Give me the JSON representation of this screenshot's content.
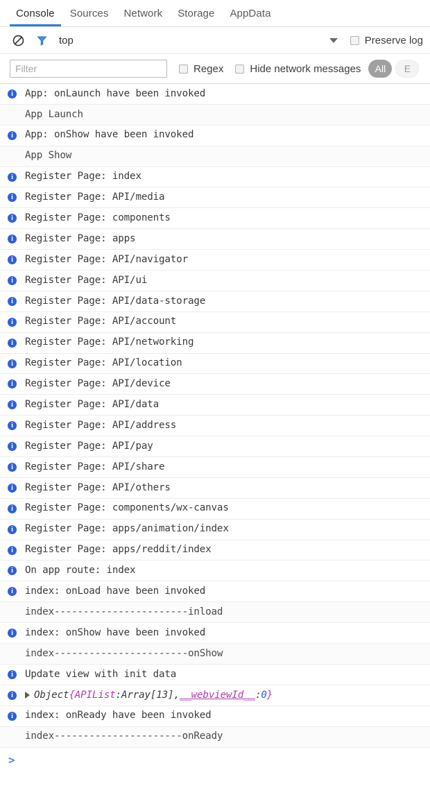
{
  "tabs": [
    {
      "label": "Console",
      "active": true
    },
    {
      "label": "Sources",
      "active": false
    },
    {
      "label": "Network",
      "active": false
    },
    {
      "label": "Storage",
      "active": false
    },
    {
      "label": "AppData",
      "active": false
    }
  ],
  "toolbar": {
    "clear_icon": "clear-console-icon",
    "filter_icon": "filter-funnel-icon",
    "context_label": "top",
    "dropdown_icon": "chevron-down-icon",
    "preserve_log_label": "Preserve log",
    "preserve_log_checked": false
  },
  "filterbar": {
    "filter_placeholder": "Filter",
    "filter_value": "",
    "regex_label": "Regex",
    "regex_checked": false,
    "hide_network_label": "Hide network messages",
    "hide_network_checked": false,
    "level_pill": "All",
    "level_pill_ghost": "E"
  },
  "console": {
    "prompt_symbol": ">",
    "entries": [
      {
        "icon": "info-icon",
        "text": "App: onLaunch have been invoked"
      },
      {
        "icon": null,
        "text": "App Launch"
      },
      {
        "icon": "info-icon",
        "text": "App: onShow have been invoked"
      },
      {
        "icon": null,
        "text": "App Show"
      },
      {
        "icon": "info-icon",
        "text": "Register Page: index"
      },
      {
        "icon": "info-icon",
        "text": "Register Page: API/media"
      },
      {
        "icon": "info-icon",
        "text": "Register Page: components"
      },
      {
        "icon": "info-icon",
        "text": "Register Page: apps"
      },
      {
        "icon": "info-icon",
        "text": "Register Page: API/navigator"
      },
      {
        "icon": "info-icon",
        "text": "Register Page: API/ui"
      },
      {
        "icon": "info-icon",
        "text": "Register Page: API/data-storage"
      },
      {
        "icon": "info-icon",
        "text": "Register Page: API/account"
      },
      {
        "icon": "info-icon",
        "text": "Register Page: API/networking"
      },
      {
        "icon": "info-icon",
        "text": "Register Page: API/location"
      },
      {
        "icon": "info-icon",
        "text": "Register Page: API/device"
      },
      {
        "icon": "info-icon",
        "text": "Register Page: API/data"
      },
      {
        "icon": "info-icon",
        "text": "Register Page: API/address"
      },
      {
        "icon": "info-icon",
        "text": "Register Page: API/pay"
      },
      {
        "icon": "info-icon",
        "text": "Register Page: API/share"
      },
      {
        "icon": "info-icon",
        "text": "Register Page: API/others"
      },
      {
        "icon": "info-icon",
        "text": "Register Page: components/wx-canvas"
      },
      {
        "icon": "info-icon",
        "text": "Register Page: apps/animation/index"
      },
      {
        "icon": "info-icon",
        "text": "Register Page: apps/reddit/index"
      },
      {
        "icon": "info-icon",
        "text": "On app route: index"
      },
      {
        "icon": "info-icon",
        "text": "index: onLoad have been invoked"
      },
      {
        "icon": null,
        "text": "index-----------------------inload"
      },
      {
        "icon": "info-icon",
        "text": "index: onShow have been invoked"
      },
      {
        "icon": null,
        "text": "index-----------------------onShow"
      },
      {
        "icon": "info-icon",
        "text": "Update view with init data"
      },
      {
        "icon": "info-icon",
        "type": "object",
        "object": {
          "name": "Object",
          "open_brace": "{",
          "key1": "APIList",
          "sep1": ": ",
          "val1": "Array[13]",
          "comma": ", ",
          "key2": "__webviewId__",
          "sep2": ": ",
          "val2": "0",
          "close_brace": "}"
        }
      },
      {
        "icon": "info-icon",
        "text": "index: onReady have been invoked"
      },
      {
        "icon": null,
        "text": "index----------------------onReady"
      }
    ]
  }
}
